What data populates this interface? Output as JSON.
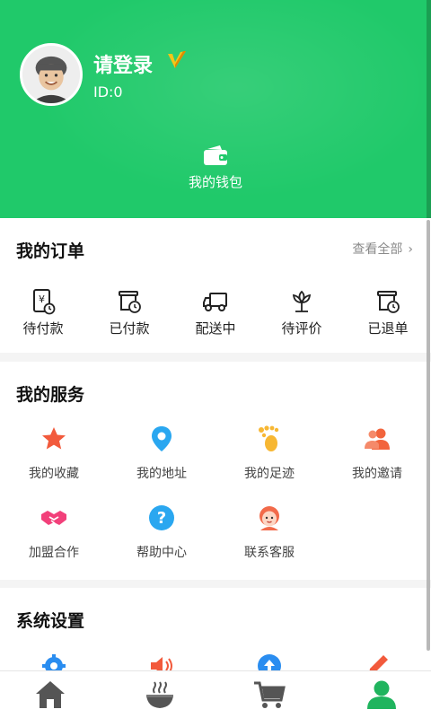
{
  "header": {
    "username": "请登录",
    "user_id": "ID:0",
    "wallet_label": "我的钱包",
    "avatar_icon": "avatar-icon",
    "vip_icon": "vip-v-badge-icon",
    "wallet_icon": "wallet-icon",
    "bg_color": "#20c96a"
  },
  "orders": {
    "title": "我的订单",
    "view_all": "查看全部",
    "items": [
      {
        "label": "待付款",
        "icon": "pending-payment-icon"
      },
      {
        "label": "已付款",
        "icon": "paid-icon"
      },
      {
        "label": "配送中",
        "icon": "delivery-truck-icon"
      },
      {
        "label": "待评价",
        "icon": "to-review-flower-icon"
      },
      {
        "label": "已退单",
        "icon": "refunded-icon"
      }
    ]
  },
  "services": {
    "title": "我的服务",
    "items": [
      {
        "label": "我的收藏",
        "icon": "star-icon",
        "color": "#f25a3c"
      },
      {
        "label": "我的地址",
        "icon": "location-pin-icon",
        "color": "#2aa7f0"
      },
      {
        "label": "我的足迹",
        "icon": "footprint-icon",
        "color": "#f7b733"
      },
      {
        "label": "我的邀请",
        "icon": "users-icon",
        "color": "#f2643c"
      },
      {
        "label": "加盟合作",
        "icon": "handshake-icon",
        "color": "#f2407a"
      },
      {
        "label": "帮助中心",
        "icon": "help-question-icon",
        "color": "#2aa7f0"
      },
      {
        "label": "联系客服",
        "icon": "customer-service-icon",
        "color": "#f26a4a"
      }
    ]
  },
  "settings": {
    "title": "系统设置",
    "items": [
      {
        "icon": "gear-icon",
        "color": "#2a8df0"
      },
      {
        "icon": "speaker-icon",
        "color": "#f25a3c"
      },
      {
        "icon": "upload-icon",
        "color": "#2a8df0"
      },
      {
        "icon": "pencil-icon",
        "color": "#f25a3c"
      }
    ]
  },
  "tabbar": {
    "items": [
      {
        "icon": "home-icon",
        "active": false
      },
      {
        "icon": "food-bowl-icon",
        "active": false
      },
      {
        "icon": "cart-icon",
        "active": false
      },
      {
        "icon": "profile-icon",
        "active": true
      }
    ],
    "active_color": "#20b45e",
    "inactive_color": "#555555"
  }
}
